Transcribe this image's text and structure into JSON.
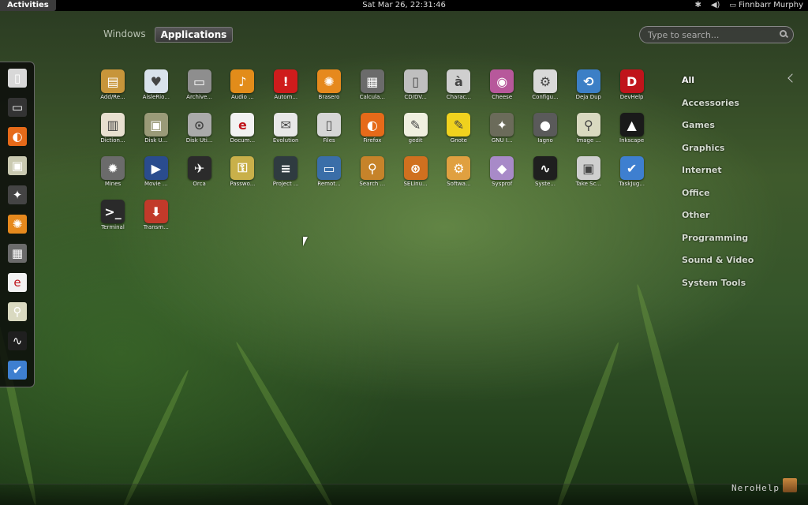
{
  "topbar": {
    "activities_label": "Activities",
    "clock": "Sat Mar 26, 22:31:46",
    "user": "Finnbarr Murphy"
  },
  "view_tabs": [
    {
      "label": "Windows",
      "active": false
    },
    {
      "label": "Applications",
      "active": true
    }
  ],
  "search": {
    "placeholder": "Type to search..."
  },
  "dash": {
    "items": [
      "files-icon",
      "terminal-icon",
      "firefox-icon",
      "folder-icon",
      "gimp-icon",
      "rotate-icon",
      "calculator-icon",
      "evolution-icon",
      "image-viewer-icon",
      "system-monitor-icon",
      "taskjuggler-icon"
    ]
  },
  "apps": [
    {
      "label": "Add/Re...",
      "icon": "package-icon",
      "color": "#c7953a",
      "glyph": "▤"
    },
    {
      "label": "AisleRio...",
      "icon": "cards-icon",
      "color": "#d9e2ec",
      "glyph": "♥"
    },
    {
      "label": "Archive...",
      "icon": "archive-icon",
      "color": "#8e8e8e",
      "glyph": "▭"
    },
    {
      "label": "Audio ...",
      "icon": "audio-cd-icon",
      "color": "#e28c1a",
      "glyph": "♪"
    },
    {
      "label": "Autom...",
      "icon": "alarm-icon",
      "color": "#cf1c1c",
      "glyph": "!"
    },
    {
      "label": "Brasero",
      "icon": "brasero-icon",
      "color": "#e6891d",
      "glyph": "✺"
    },
    {
      "label": "Calcula...",
      "icon": "calculator-icon",
      "color": "#6b6b6b",
      "glyph": "▦"
    },
    {
      "label": "CD/DV...",
      "icon": "cd-dvd-icon",
      "color": "#bfbfbf",
      "glyph": "▯"
    },
    {
      "label": "Charac...",
      "icon": "character-map-icon",
      "color": "#cfcfcf",
      "glyph": "à"
    },
    {
      "label": "Cheese",
      "icon": "cheese-icon",
      "color": "#b7589b",
      "glyph": "◉"
    },
    {
      "label": "Configu...",
      "icon": "configuration-icon",
      "color": "#d9d9d9",
      "glyph": "⚙"
    },
    {
      "label": "Deja Dup",
      "icon": "deja-dup-icon",
      "color": "#3c7fc6",
      "glyph": "⟲"
    },
    {
      "label": "DevHelp",
      "icon": "devhelp-icon",
      "color": "#c0141b",
      "glyph": "D"
    },
    {
      "label": "Diction...",
      "icon": "dictionary-icon",
      "color": "#e8e0d0",
      "glyph": "▥"
    },
    {
      "label": "Disk U...",
      "icon": "disk-usage-icon",
      "color": "#9a9a78",
      "glyph": "▣"
    },
    {
      "label": "Disk Uti...",
      "icon": "disk-utility-icon",
      "color": "#aaaaaa",
      "glyph": "⊙"
    },
    {
      "label": "Docum...",
      "icon": "document-viewer-icon",
      "color": "#f2f2f2",
      "glyph": "e"
    },
    {
      "label": "Evolution",
      "icon": "evolution-icon",
      "color": "#e8e8e8",
      "glyph": "✉"
    },
    {
      "label": "Files",
      "icon": "files-icon",
      "color": "#d6d6d6",
      "glyph": "▯"
    },
    {
      "label": "Firefox",
      "icon": "firefox-icon",
      "color": "#e66a19",
      "glyph": "◐"
    },
    {
      "label": "gedit",
      "icon": "gedit-icon",
      "color": "#f0f0e0",
      "glyph": "✎"
    },
    {
      "label": "Gnote",
      "icon": "gnote-icon",
      "color": "#f0d21e",
      "glyph": "✎"
    },
    {
      "label": "GNU I...",
      "icon": "gimp-icon",
      "color": "#6b6b5a",
      "glyph": "✦"
    },
    {
      "label": "Iagno",
      "icon": "iagno-icon",
      "color": "#5a5a5a",
      "glyph": "●"
    },
    {
      "label": "Image ...",
      "icon": "image-viewer-icon",
      "color": "#d9d9c0",
      "glyph": "⚲"
    },
    {
      "label": "Inkscape",
      "icon": "inkscape-icon",
      "color": "#1a1a1a",
      "glyph": "▲"
    },
    {
      "label": "Mines",
      "icon": "mines-icon",
      "color": "#6b6b6b",
      "glyph": "✹"
    },
    {
      "label": "Movie ...",
      "icon": "movie-player-icon",
      "color": "#2a4c8e",
      "glyph": "▶"
    },
    {
      "label": "Orca",
      "icon": "orca-icon",
      "color": "#2b2b2b",
      "glyph": "✈"
    },
    {
      "label": "Passwo...",
      "icon": "passwords-icon",
      "color": "#c9b04a",
      "glyph": "⚿"
    },
    {
      "label": "Project ...",
      "icon": "project-icon",
      "color": "#2f3b40",
      "glyph": "≡"
    },
    {
      "label": "Remot...",
      "icon": "remote-desktop-icon",
      "color": "#3a6ea8",
      "glyph": "▭"
    },
    {
      "label": "Search ...",
      "icon": "search-tool-icon",
      "color": "#c6832a",
      "glyph": "⚲"
    },
    {
      "label": "SELinu...",
      "icon": "selinux-icon",
      "color": "#d0701f",
      "glyph": "⊛"
    },
    {
      "label": "Softwa...",
      "icon": "software-icon",
      "color": "#e0a040",
      "glyph": "⚙"
    },
    {
      "label": "Sysprof",
      "icon": "sysprof-icon",
      "color": "#a88ac8",
      "glyph": "◆"
    },
    {
      "label": "Syste...",
      "icon": "system-monitor-icon",
      "color": "#1f1f1f",
      "glyph": "∿"
    },
    {
      "label": "Take Sc...",
      "icon": "screenshot-icon",
      "color": "#cfcfcf",
      "glyph": "▣"
    },
    {
      "label": "TaskJug...",
      "icon": "taskjuggler-icon",
      "color": "#3e7fd0",
      "glyph": "✔"
    },
    {
      "label": "Terminal",
      "icon": "terminal-icon",
      "color": "#2a2a2a",
      "glyph": ">_"
    },
    {
      "label": "Transm...",
      "icon": "transmission-icon",
      "color": "#c23a2a",
      "glyph": "⬇"
    }
  ],
  "categories": [
    {
      "label": "All",
      "active": true
    },
    {
      "label": "Accessories"
    },
    {
      "label": "Games"
    },
    {
      "label": "Graphics"
    },
    {
      "label": "Internet"
    },
    {
      "label": "Office"
    },
    {
      "label": "Other"
    },
    {
      "label": "Programming"
    },
    {
      "label": "Sound & Video"
    },
    {
      "label": "System Tools"
    }
  ],
  "watermark": "NeroHelp"
}
